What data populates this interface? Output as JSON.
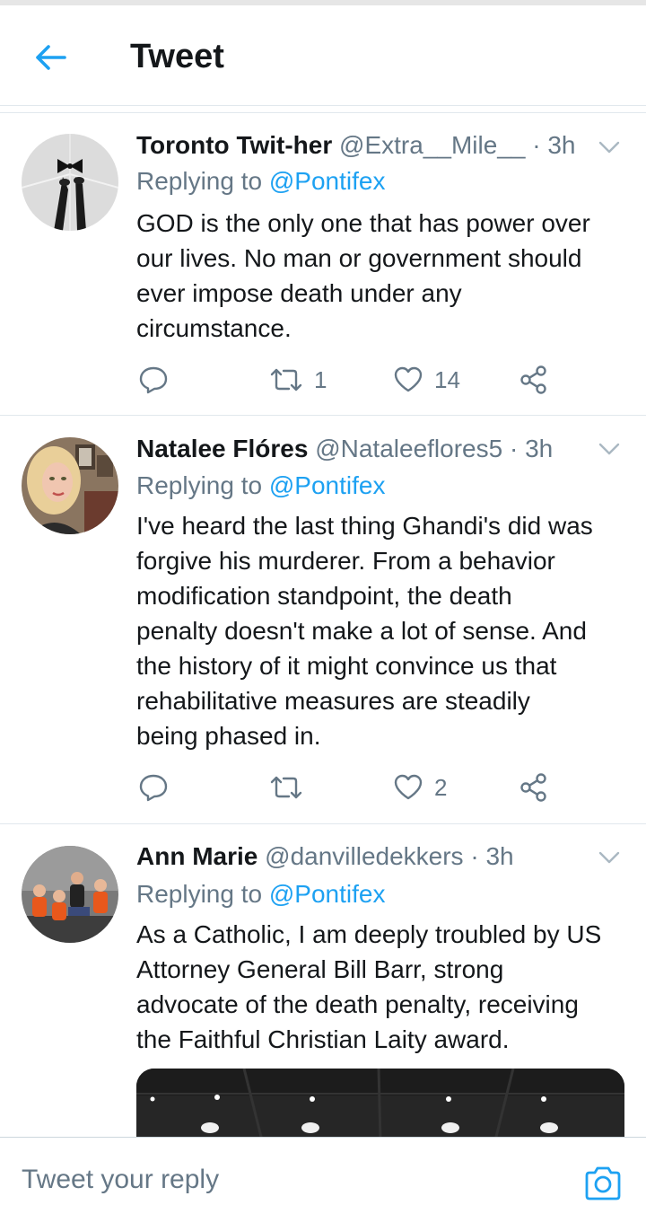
{
  "header": {
    "title": "Tweet"
  },
  "tweets": [
    {
      "name": "Toronto Twit-her",
      "handle": "@Extra__Mile__",
      "time": "· 3h",
      "replying_prefix": "Replying to",
      "replying_to": "@Pontifex",
      "lines": [
        "GOD is the only one that has power over",
        "our lives. No man or government should",
        "ever impose death under any",
        "circumstance."
      ],
      "retweets": "1",
      "likes": "14"
    },
    {
      "name": "Natalee Flóres",
      "handle": "@Nataleeflores5",
      "time": "· 3h",
      "replying_prefix": "Replying to",
      "replying_to": "@Pontifex",
      "lines": [
        "I've heard the last thing Ghandi's did was",
        "forgive his murderer. From a behavior",
        "modification standpoint, the death",
        "penalty doesn't make a lot of sense. And",
        "the history of it might convince us that",
        "rehabilitative measures are steadily",
        "being phased in."
      ],
      "retweets": "",
      "likes": "2"
    },
    {
      "name": "Ann Marie",
      "handle": "@danvilledekkers",
      "time": "· 3h",
      "replying_prefix": "Replying to",
      "replying_to": "@Pontifex",
      "lines": [
        "As a Catholic, I am deeply troubled by US",
        "Attorney General Bill Barr, strong",
        "advocate of the death penalty, receiving",
        "the Faithful Christian Laity award."
      ]
    }
  ],
  "reply_bar": {
    "placeholder": "Tweet your reply"
  },
  "colors": {
    "accent": "#1da1f2",
    "secondary_text": "#657786",
    "primary_text": "#14171a",
    "divider": "#e1e8ed"
  },
  "icons": {
    "back": "arrow-left-icon",
    "menu": "chevron-down-icon",
    "reply": "reply-icon",
    "retweet": "retweet-icon",
    "like": "heart-icon",
    "share": "share-icon",
    "camera": "camera-icon"
  }
}
